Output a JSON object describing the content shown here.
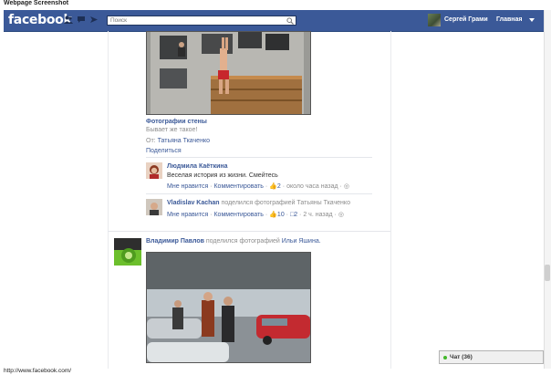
{
  "caption": {
    "title": "Webpage Screenshot",
    "url": "http://www.facebook.com/"
  },
  "topbar": {
    "logo": "facebook",
    "search_placeholder": "Поиск",
    "profile_name": "Сергей Грами",
    "home_label": "Главная",
    "color": "#3b5998",
    "icons": [
      "friend-requests-icon",
      "messages-icon",
      "notifications-icon",
      "search-icon",
      "chevron-down-icon"
    ]
  },
  "post1": {
    "source": "Фотографии стены",
    "caption": "Бывает же такое!",
    "from_label": "От:",
    "from_name": "Татьяна Ткаченко",
    "share": "Поделиться",
    "comments": [
      {
        "author": "Людмила Каёткина",
        "text": "Веселая история из жизни. Смейтесь",
        "like": "Мне нравится",
        "comment": "Комментировать",
        "likes": "2",
        "time": "около часа назад"
      },
      {
        "author": "Vladislav Kachan",
        "action": "поделился фотографией Татьяны Ткаченко",
        "like": "Мне нравится",
        "comment": "Комментировать",
        "likes": "10",
        "comments_count": "2",
        "time": "2 ч. назад"
      }
    ]
  },
  "post2": {
    "author": "Владимир Павлов",
    "action": "поделился фотографией",
    "target": "Ильи Яшина."
  },
  "chat": {
    "label": "Чат (36)",
    "status_color": "#42b72a"
  }
}
